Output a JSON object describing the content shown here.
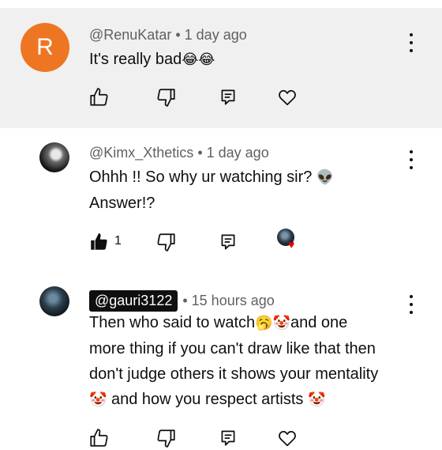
{
  "comments": [
    {
      "avatar_letter": "R",
      "handle": "@RenuKatar",
      "time": "1 day ago",
      "text": "It's really bad",
      "emoji": "😂😂",
      "colors": {
        "avatar": "#ee7622",
        "background": "#f0f0f0"
      }
    },
    {
      "handle": "@Kimx_Xthetics",
      "time": "1 day ago",
      "text_line1": "Ohhh !! So why ur watching sir?",
      "text_line1_emoji": "👽",
      "text_line2": "Answer!?",
      "like_count": "1"
    },
    {
      "handle": "@gauri3122",
      "time": "15 hours ago",
      "line1_a": "Then who said to watch",
      "line1_emoji": "🥱🤡",
      "line1_b": "and one",
      "line2": "more thing if you can't draw like that then",
      "line3": "don't judge others it shows your mentality",
      "line4_emoji": "🤡",
      "line4": " and how you respect artists ",
      "line4_emoji_end": "🤡"
    }
  ],
  "icons": [
    "thumbs-up-icon",
    "thumbs-down-icon",
    "reply-icon",
    "heart-icon",
    "more-options-icon"
  ]
}
